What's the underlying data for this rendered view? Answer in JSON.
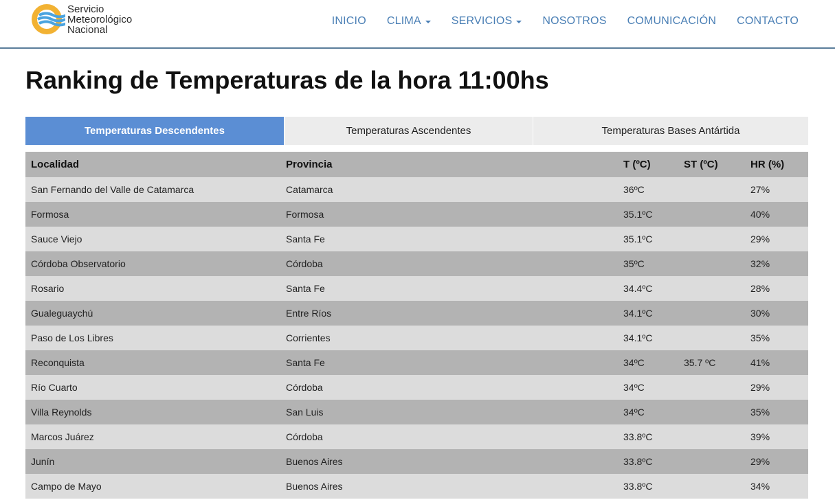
{
  "brand": {
    "name_line1": "Servicio",
    "name_line2": "Meteorológico",
    "name_line3": "Nacional",
    "colors": {
      "ring": "#f2b233",
      "wave": "#4aa3df"
    }
  },
  "nav": {
    "items": [
      "INICIO",
      "CLIMA",
      "SERVICIOS",
      "NOSOTROS",
      "COMUNICACIÓN",
      "CONTACTO"
    ],
    "accent": "#4a7fb5"
  },
  "page": {
    "title": "Ranking de Temperaturas de la hora 11:00hs"
  },
  "tabs": {
    "items": [
      "Temperaturas Descendentes",
      "Temperaturas Ascendentes",
      "Temperaturas Bases Antártida"
    ],
    "active_index": 0,
    "active_color": "#5b8ed4"
  },
  "table": {
    "headers": [
      "Localidad",
      "Provincia",
      "T (ºC)",
      "ST (ºC)",
      "HR (%)"
    ],
    "rows": [
      [
        "San Fernando del Valle de Catamarca",
        "Catamarca",
        "36ºC",
        "",
        "27%"
      ],
      [
        "Formosa",
        "Formosa",
        "35.1ºC",
        "",
        "40%"
      ],
      [
        "Sauce Viejo",
        "Santa Fe",
        "35.1ºC",
        "",
        "29%"
      ],
      [
        "Córdoba Observatorio",
        "Córdoba",
        "35ºC",
        "",
        "32%"
      ],
      [
        "Rosario",
        "Santa Fe",
        "34.4ºC",
        "",
        "28%"
      ],
      [
        "Gualeguaychú",
        "Entre Ríos",
        "34.1ºC",
        "",
        "30%"
      ],
      [
        "Paso de Los Libres",
        "Corrientes",
        "34.1ºC",
        "",
        "35%"
      ],
      [
        "Reconquista",
        "Santa Fe",
        "34ºC",
        "35.7 ºC",
        "41%"
      ],
      [
        "Río Cuarto",
        "Córdoba",
        "34ºC",
        "",
        "29%"
      ],
      [
        "Villa Reynolds",
        "San Luis",
        "34ºC",
        "",
        "35%"
      ],
      [
        "Marcos Juárez",
        "Córdoba",
        "33.8ºC",
        "",
        "39%"
      ],
      [
        "Junín",
        "Buenos Aires",
        "33.8ºC",
        "",
        "29%"
      ],
      [
        "Campo de Mayo",
        "Buenos Aires",
        "33.8ºC",
        "",
        "34%"
      ]
    ]
  }
}
